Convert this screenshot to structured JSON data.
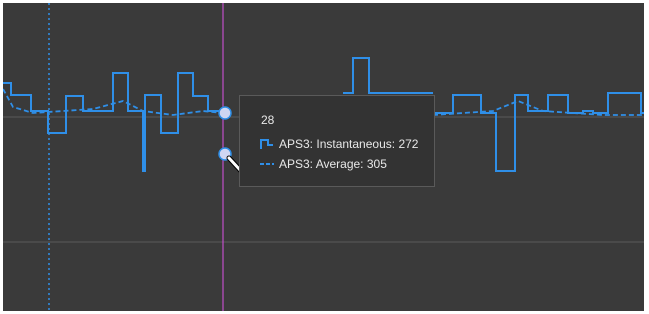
{
  "colors": {
    "background": "#3a3a3a",
    "gridline": "#5b5b5b",
    "series": "#2f8fe8",
    "cursor": "#c04ec8",
    "marker_fill": "#cfd6f2"
  },
  "tooltip": {
    "x_value": "28",
    "rows": [
      {
        "icon": "step-line-icon",
        "label": "APS3: Instantaneous:",
        "value": "272"
      },
      {
        "icon": "dashed-line-icon",
        "label": "APS3: Average:",
        "value": "305"
      }
    ]
  },
  "chart_data": {
    "type": "line",
    "x_cursor": 28,
    "series": [
      {
        "name": "APS3: Instantaneous",
        "style": "step",
        "cursor_value": 272
      },
      {
        "name": "APS3: Average",
        "style": "dashed",
        "cursor_value": 305
      }
    ]
  }
}
